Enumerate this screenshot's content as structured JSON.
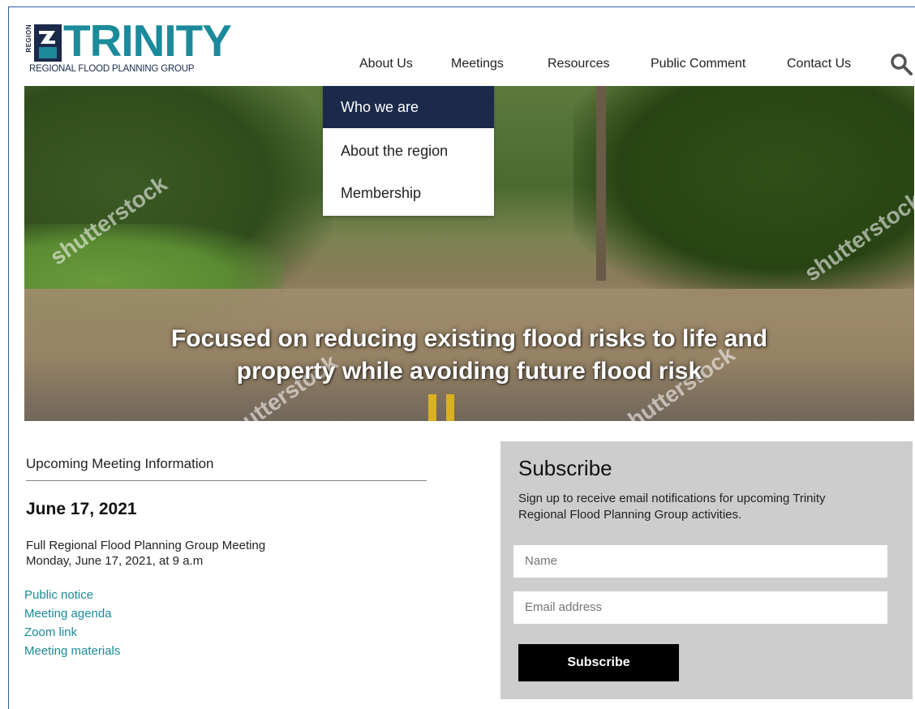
{
  "logo": {
    "badge": "3",
    "region_label": "REGION",
    "name": "TRINITY",
    "subtitle": "REGIONAL FLOOD PLANNING GROUP"
  },
  "nav": {
    "items": [
      "About Us",
      "Meetings",
      "Resources",
      "Public Comment",
      "Contact Us"
    ],
    "search_icon": "search-icon"
  },
  "dropdown": {
    "items": [
      "Who we are",
      "About the region",
      "Membership"
    ],
    "active_index": 0
  },
  "hero": {
    "headline_line1": "Focused on reducing existing flood risks to life and",
    "headline_line2": "property while avoiding future flood risk",
    "watermark": "shutterstock"
  },
  "meeting": {
    "heading": "Upcoming Meeting Information",
    "date": "June 17, 2021",
    "title": "Full Regional Flood Planning Group Meeting",
    "when": "Monday, June 17, 2021, at 9 a.m",
    "links": [
      "Public notice",
      "Meeting agenda",
      "Zoom link",
      "Meeting materials"
    ]
  },
  "subscribe": {
    "title": "Subscribe",
    "description": "Sign up to receive email notifications for upcoming Trinity Regional Flood Planning Group activities.",
    "name_placeholder": "Name",
    "email_placeholder": "Email address",
    "button_label": "Subscribe"
  },
  "colors": {
    "brand_teal": "#1b8a9a",
    "brand_navy": "#1b2a4a",
    "subscribe_bg": "#cdcdcd"
  }
}
